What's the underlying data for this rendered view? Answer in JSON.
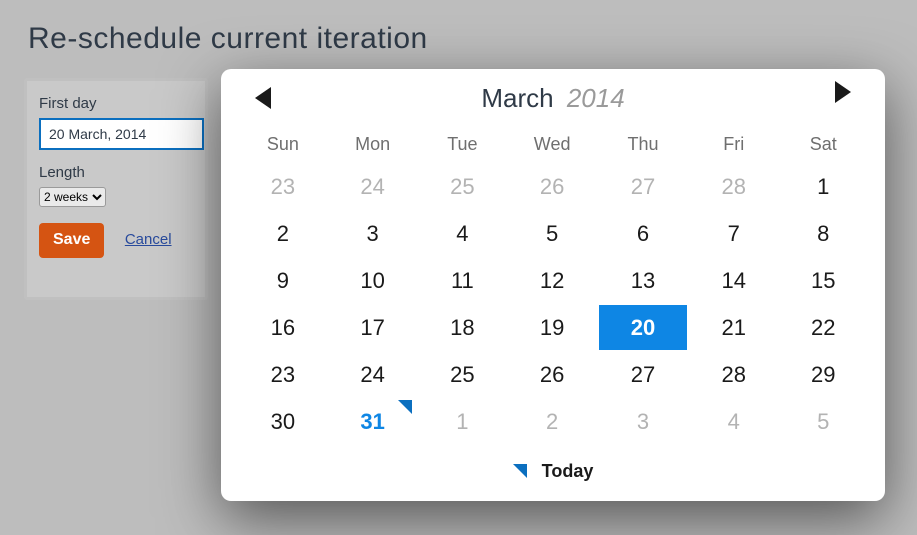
{
  "page": {
    "title": "Re-schedule current iteration"
  },
  "form": {
    "first_day_label": "First day",
    "first_day_value": "20 March, 2014",
    "length_label": "Length",
    "length_value": "2 weeks",
    "save_label": "Save",
    "cancel_label": "Cancel"
  },
  "datepicker": {
    "month": "March",
    "year": "2014",
    "weekdays": [
      "Sun",
      "Mon",
      "Tue",
      "Wed",
      "Thu",
      "Fri",
      "Sat"
    ],
    "selected_day": 20,
    "today_label": "Today",
    "weeks": [
      [
        {
          "n": 23,
          "other": true
        },
        {
          "n": 24,
          "other": true
        },
        {
          "n": 25,
          "other": true
        },
        {
          "n": 26,
          "other": true
        },
        {
          "n": 27,
          "other": true
        },
        {
          "n": 28,
          "other": true
        },
        {
          "n": 1
        }
      ],
      [
        {
          "n": 2
        },
        {
          "n": 3
        },
        {
          "n": 4
        },
        {
          "n": 5
        },
        {
          "n": 6
        },
        {
          "n": 7
        },
        {
          "n": 8
        }
      ],
      [
        {
          "n": 9
        },
        {
          "n": 10
        },
        {
          "n": 11
        },
        {
          "n": 12
        },
        {
          "n": 13
        },
        {
          "n": 14
        },
        {
          "n": 15
        }
      ],
      [
        {
          "n": 16
        },
        {
          "n": 17
        },
        {
          "n": 18
        },
        {
          "n": 19
        },
        {
          "n": 20,
          "selected": true
        },
        {
          "n": 21
        },
        {
          "n": 22
        }
      ],
      [
        {
          "n": 23
        },
        {
          "n": 24
        },
        {
          "n": 25
        },
        {
          "n": 26
        },
        {
          "n": 27
        },
        {
          "n": 28
        },
        {
          "n": 29
        }
      ],
      [
        {
          "n": 30
        },
        {
          "n": 31,
          "today": true
        },
        {
          "n": 1,
          "other": true
        },
        {
          "n": 2,
          "other": true
        },
        {
          "n": 3,
          "other": true
        },
        {
          "n": 4,
          "other": true
        },
        {
          "n": 5,
          "other": true
        }
      ]
    ]
  }
}
